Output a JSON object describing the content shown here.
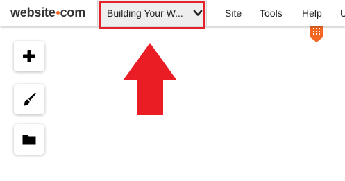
{
  "colors": {
    "accent": "#f26722",
    "highlight": "#e4222a",
    "arrow": "#ea1c24",
    "icon": "#000000"
  },
  "header": {
    "logo": {
      "part1": "website",
      "part2": "com"
    },
    "page_select": {
      "value": "Building Your W...",
      "chevron_icon": "chevron-down-icon"
    },
    "menu": [
      {
        "label": "Site"
      },
      {
        "label": "Tools"
      },
      {
        "label": "Help"
      },
      {
        "label": "U"
      }
    ]
  },
  "toolbar": {
    "buttons": [
      {
        "icon": "plus-icon"
      },
      {
        "icon": "paintbrush-icon"
      },
      {
        "icon": "folder-icon"
      }
    ]
  },
  "annotation": {
    "icon": "up-arrow-icon"
  },
  "guide": {
    "icon": "grid-handle-icon"
  }
}
